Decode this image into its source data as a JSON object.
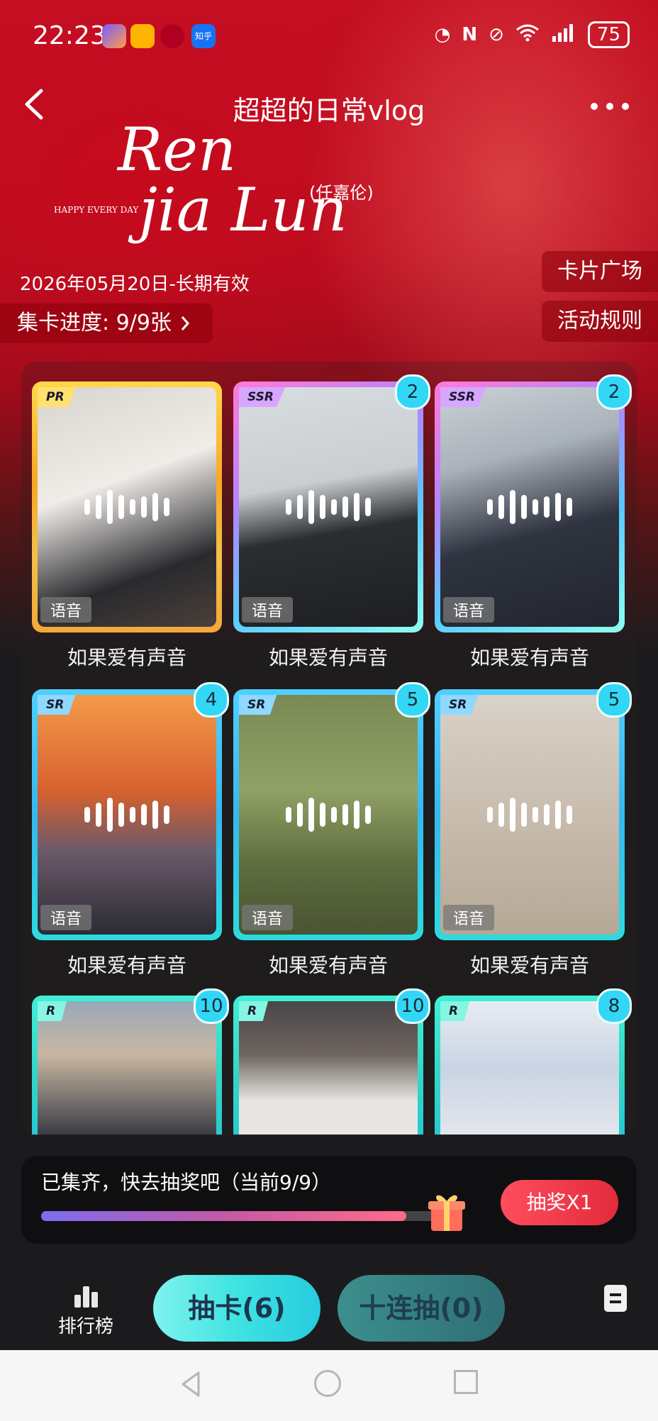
{
  "status_bar": {
    "time": "22:23",
    "battery": "75",
    "app_icons": [
      "photos-app-icon",
      "weibo-app-icon",
      "red-app-icon",
      "zhihu-app-icon"
    ],
    "zhihu_label": "知乎"
  },
  "header": {
    "title": "超超的日常vlog",
    "logo_script_line1": "Ren",
    "logo_script_line2": "jia Lun",
    "logo_tag": "HAPPY EVERY DAY",
    "logo_cn": "(任嘉伦)"
  },
  "info": {
    "date_range": "2026年05月20日-长期有效",
    "collect_progress": "集卡进度: 9/9张",
    "card_plaza": "卡片广场",
    "event_rules": "活动规则"
  },
  "cards": [
    {
      "rarity": "PR",
      "count": "",
      "tag": "语音",
      "name": "如果爱有声音"
    },
    {
      "rarity": "SSR",
      "count": "2",
      "tag": "语音",
      "name": "如果爱有声音"
    },
    {
      "rarity": "SSR",
      "count": "2",
      "tag": "语音",
      "name": "如果爱有声音"
    },
    {
      "rarity": "SR",
      "count": "4",
      "tag": "语音",
      "name": "如果爱有声音"
    },
    {
      "rarity": "SR",
      "count": "5",
      "tag": "语音",
      "name": "如果爱有声音"
    },
    {
      "rarity": "SR",
      "count": "5",
      "tag": "语音",
      "name": "如果爱有声音"
    },
    {
      "rarity": "R",
      "count": "10",
      "tag": "",
      "name": ""
    },
    {
      "rarity": "R",
      "count": "10",
      "tag": "",
      "name": ""
    },
    {
      "rarity": "R",
      "count": "8",
      "tag": "",
      "name": ""
    }
  ],
  "lottery": {
    "message": "已集齐，快去抽奖吧（当前9/9）",
    "progress": 0.9,
    "button": "抽奖X1"
  },
  "bottom": {
    "rank_label": "排行榜",
    "draw_one": "抽卡(6)",
    "draw_ten": "十连抽(0)"
  },
  "colors": {
    "hero_red": "#c40f22",
    "dark_bg": "#1b1b1d",
    "accent_cyan": "#3ee3e1",
    "lottery_red": "#e22b3c"
  }
}
